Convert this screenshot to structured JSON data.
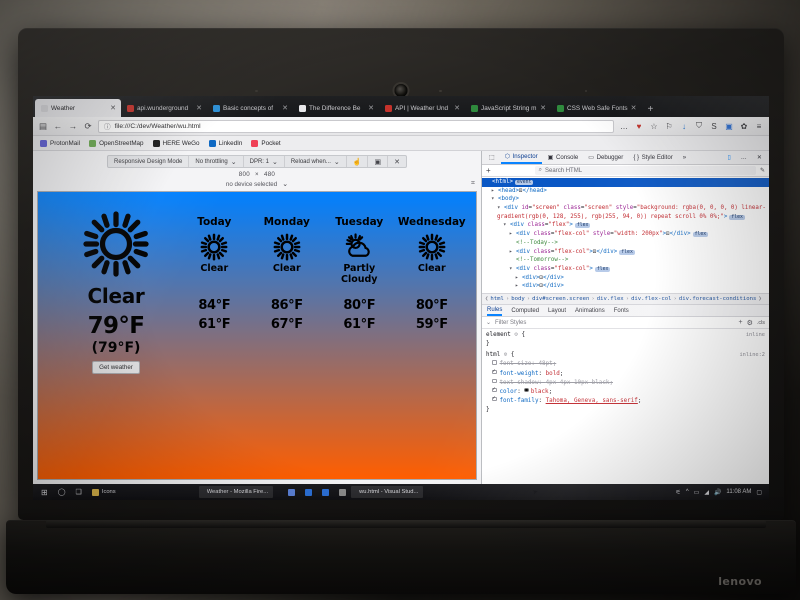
{
  "browser": {
    "tabs": [
      {
        "label": "Weather",
        "favicon": "#d8d8dc",
        "active": true
      },
      {
        "label": "api.wunderground",
        "favicon": "#c4322b",
        "active": false
      },
      {
        "label": "Basic concepts of",
        "favicon": "#2b8fd6",
        "active": false
      },
      {
        "label": "The Difference Be",
        "favicon": "#e8e8ea",
        "active": false
      },
      {
        "label": "API | Weather Und",
        "favicon": "#c4322b",
        "active": false
      },
      {
        "label": "JavaScript String m",
        "favicon": "#2f8a3d",
        "active": false
      },
      {
        "label": "CSS Web Safe Fonts",
        "favicon": "#2f8a3d",
        "active": false
      }
    ],
    "new_tab_label": "+",
    "nav": {
      "sidebar_icon": "▤",
      "back_icon": "←",
      "forward_icon": "→",
      "reload_icon": "⟳",
      "shield_icon": "ⓘ",
      "url": "file:///C:/dev/Weather/wu.html",
      "right_icons": [
        "…",
        "♥",
        "☆",
        "⚐",
        "↓",
        "🛡",
        "S",
        "▣",
        "✿",
        "≡"
      ]
    },
    "bookmarks": [
      {
        "label": "ProtonMail",
        "color": "#5b5bd6"
      },
      {
        "label": "OpenStreetMap",
        "color": "#6aa84f"
      },
      {
        "label": "HERE WeGo",
        "color": "#1a1a1a"
      },
      {
        "label": "LinkedIn",
        "color": "#0a66c2"
      },
      {
        "label": "Pocket",
        "color": "#ef4056"
      }
    ]
  },
  "rdm": {
    "title": "Responsive Design Mode",
    "throttling": "No throttling",
    "dpr": "DPR: 1",
    "reload_when": "Reload when...",
    "touch_icon": "☝",
    "camera_icon": "▣",
    "close_icon": "✕",
    "width": "800",
    "times": "×",
    "height": "480",
    "device": "no device selected",
    "device_caret": "⌄",
    "screenshot_icon": "⌗"
  },
  "weather_app": {
    "gradient_top": "rgb(0, 128, 255)",
    "gradient_bottom": "rgb(255, 94, 0)",
    "current": {
      "icon": "sun-icon",
      "condition": "Clear",
      "temperature": "79°F",
      "feels_like": "(79°F)",
      "button_label": "Get weather"
    },
    "forecast": [
      {
        "day": "Today",
        "icon": "sun-icon",
        "condition": "Clear",
        "high": "84°F",
        "low": "61°F"
      },
      {
        "day": "Monday",
        "icon": "sun-icon",
        "condition": "Clear",
        "high": "86°F",
        "low": "67°F"
      },
      {
        "day": "Tuesday",
        "icon": "sun-cloud-icon",
        "condition": "Partly Cloudy",
        "high": "80°F",
        "low": "61°F"
      },
      {
        "day": "Wednesday",
        "icon": "sun-icon",
        "condition": "Clear",
        "high": "80°F",
        "low": "59°F"
      }
    ]
  },
  "devtools": {
    "tabs": [
      {
        "label": "Inspector",
        "icon": "⬡",
        "active": true
      },
      {
        "label": "Console",
        "icon": "▣",
        "active": false
      },
      {
        "label": "Debugger",
        "icon": "▭",
        "active": false
      },
      {
        "label": "Style Editor",
        "icon": "{ }",
        "active": false
      }
    ],
    "overflow_icon": "»",
    "rdm_toggle_icon": "▯",
    "meatball_icon": "…",
    "close_icon": "✕",
    "add_node_icon": "+",
    "search_placeholder": "Search HTML",
    "search_icon": "⌕",
    "pick_icon": "✎",
    "markup": [
      {
        "indent": 0,
        "twisty": "",
        "html": "<span class='tag'>&lt;html&gt;</span><span class='badge'>event</span>",
        "selected": true
      },
      {
        "indent": 1,
        "twisty": "▸",
        "html": "<span class='tag'>&lt;head&gt;</span>⊡<span class='tag'>&lt;/head&gt;</span>",
        "selected": false
      },
      {
        "indent": 1,
        "twisty": "▾",
        "html": "<span class='tag'>&lt;body&gt;</span>",
        "selected": false
      },
      {
        "indent": 2,
        "twisty": "▾",
        "html": "<span class='tag'>&lt;div</span> <span class='attr'>id</span>=<span class='val'>\"screen\"</span> <span class='attr'>class</span>=<span class='val'>\"screen\"</span> <span class='attr'>style</span>=<span class='val'>\"background: rgba(0, 0, 0, 0) linear-gradient(rgb(0, 128, 255), rgb(255, 94, 0)) repeat scroll 0% 0%;\"</span><span class='tag'>&gt;</span><span class='badge'>flex</span>",
        "selected": false
      },
      {
        "indent": 3,
        "twisty": "▾",
        "html": "<span class='tag'>&lt;div</span> <span class='attr'>class</span>=<span class='val'>\"flex\"</span><span class='tag'>&gt;</span><span class='badge'>flex</span>",
        "selected": false
      },
      {
        "indent": 4,
        "twisty": "▸",
        "html": "<span class='tag'>&lt;div</span> <span class='attr'>class</span>=<span class='val'>\"flex-col\"</span> <span class='attr'>style</span>=<span class='val'>\"width: 200px\"</span><span class='tag'>&gt;</span>⊡<span class='tag'>&lt;/div&gt;</span><span class='badge'>flex</span>",
        "selected": false
      },
      {
        "indent": 4,
        "twisty": "",
        "html": "<span class='cmt'>&lt;!--Today--&gt;</span>",
        "selected": false
      },
      {
        "indent": 4,
        "twisty": "▸",
        "html": "<span class='tag'>&lt;div</span> <span class='attr'>class</span>=<span class='val'>\"flex-col\"</span><span class='tag'>&gt;</span>⊡<span class='tag'>&lt;/div&gt;</span><span class='badge'>flex</span>",
        "selected": false
      },
      {
        "indent": 4,
        "twisty": "",
        "html": "<span class='cmt'>&lt;!--Tomorrow--&gt;</span>",
        "selected": false
      },
      {
        "indent": 4,
        "twisty": "▾",
        "html": "<span class='tag'>&lt;div</span> <span class='attr'>class</span>=<span class='val'>\"flex-col\"</span><span class='tag'>&gt;</span><span class='badge'>flex</span>",
        "selected": false
      },
      {
        "indent": 5,
        "twisty": "▸",
        "html": "<span class='tag'>&lt;div&gt;</span>⊡<span class='tag'>&lt;/div&gt;</span>",
        "selected": false
      },
      {
        "indent": 5,
        "twisty": "▸",
        "html": "<span class='tag'>&lt;div&gt;</span>⊡<span class='tag'>&lt;/div&gt;</span>",
        "selected": false
      }
    ],
    "breadcrumb": [
      "html",
      "body",
      "div#screen.screen",
      "div.flex",
      "div.flex-col",
      "div.forecast-conditions"
    ],
    "breadcrumb_prev_icon": "❮",
    "breadcrumb_next_icon": "❯",
    "rule_tabs": [
      {
        "label": "Rules",
        "active": true
      },
      {
        "label": "Computed",
        "active": false
      },
      {
        "label": "Layout",
        "active": false
      },
      {
        "label": "Animations",
        "active": false
      },
      {
        "label": "Fonts",
        "active": false
      }
    ],
    "filter_placeholder": "Filter Styles",
    "filter_icon": "⌄",
    "add_rule_icon": "+",
    "pseudo_icon": "⚙",
    "light_icon": ".cls",
    "rules": [
      {
        "kind": "selector",
        "text": "element",
        "pseudo": "⊙",
        "open": "{",
        "source": "inline"
      },
      {
        "kind": "close",
        "text": "}"
      },
      {
        "kind": "selector",
        "text": "html",
        "pseudo": "⊙",
        "open": "{",
        "source": "inline:2"
      },
      {
        "kind": "decl",
        "prop": "font-size",
        "value": "48pt",
        "enabled": false,
        "swatch": false
      },
      {
        "kind": "decl",
        "prop": "font-weight",
        "value": "bold",
        "enabled": true,
        "swatch": false
      },
      {
        "kind": "decl",
        "prop": "text-shadow",
        "value": "4px 4px 10px black",
        "enabled": false,
        "swatch": false
      },
      {
        "kind": "decl",
        "prop": "color",
        "value": "black",
        "enabled": true,
        "swatch": true
      },
      {
        "kind": "decl",
        "prop": "font-family",
        "value": "Tahoma, Geneva, sans-serif",
        "enabled": true,
        "swatch": false,
        "underline_first": true
      },
      {
        "kind": "close",
        "text": "}"
      }
    ]
  },
  "taskbar": {
    "start_icon": "⊞",
    "search_icon": "◯",
    "taskview_icon": "❑",
    "pinned": [
      {
        "label": "Icons",
        "color": "#d9b44a"
      }
    ],
    "windows": [
      {
        "label": "Weather - Mozilla Fire...",
        "color": "#e8762b"
      },
      {
        "label": "wu.html - Visual Stud...",
        "color": "#7a4fbf"
      }
    ],
    "tray_pinned": [
      {
        "color": "#5a7fd6"
      },
      {
        "color": "#2b6fd6"
      },
      {
        "color": "#2b6fd6"
      },
      {
        "color": "#8a8a8a"
      }
    ],
    "tray": [
      "⚟",
      "^",
      "▭",
      "◢",
      "🔊"
    ],
    "clock": "11:08 AM",
    "notify_icon": "▢"
  },
  "hardware": {
    "brand": "lenovo",
    "webcam": "webcam-icon"
  }
}
